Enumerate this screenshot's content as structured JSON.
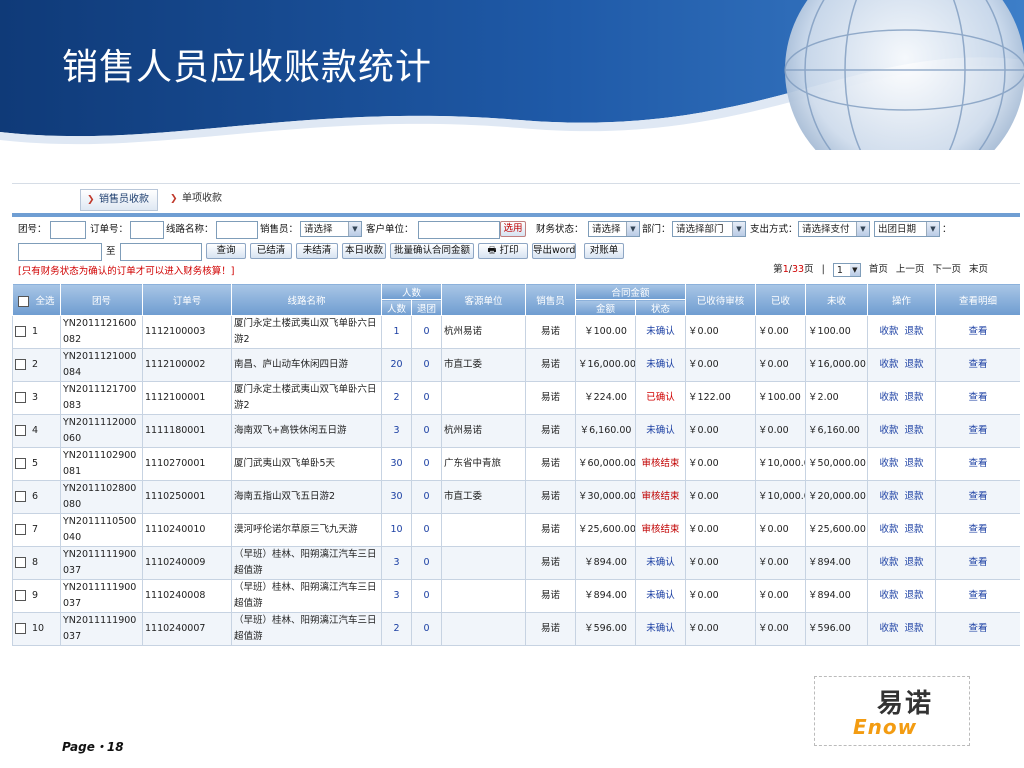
{
  "slide": {
    "title": "销售人员应收账款统计",
    "page_label": "Page・18",
    "logo_cn": "易诺",
    "logo_en": "Enow"
  },
  "tabs": [
    {
      "label": "销售员收款",
      "active": true
    },
    {
      "label": "单项收款",
      "active": false
    }
  ],
  "filters": {
    "group_no_label": "团号：",
    "order_no_label": "订单号：",
    "route_label": "线路名称：",
    "sales_label": "销售员：",
    "sales_value": "请选择",
    "customer_label": "客户单位：",
    "pick_button": "选用",
    "finance_status_label": "财务状态：",
    "finance_status_value": "请选择",
    "dept_label": "部门：",
    "dept_value": "请选择部门",
    "pay_method_label": "支出方式：",
    "pay_method_value": "请选择支付",
    "date_type_value": "出团日期",
    "date_colon": "：",
    "to_label": "至",
    "buttons": {
      "query": "查询",
      "settled": "已结清",
      "unsettled": "未结清",
      "today": "本日收款",
      "batch_confirm": "批量确认合同金额",
      "print": "打印",
      "export": "导出word",
      "reconcile": "对账单"
    },
    "warning": "[只有财务状态为确认的订单才可以进入财务核算！]"
  },
  "pager": {
    "prefix": "第",
    "current": "1",
    "sep": "/",
    "total": "33",
    "suffix": "页",
    "divider": "|",
    "select_value": "1",
    "first": "首页",
    "prev": "上一页",
    "next": "下一页",
    "last": "末页"
  },
  "table": {
    "headers": {
      "select_all": "全选",
      "group_no": "团号",
      "order_no": "订单号",
      "route": "线路名称",
      "people": "人数",
      "people_count": "人数",
      "people_return": "退团",
      "source": "客源单位",
      "sales": "销售员",
      "contract": "合同金额",
      "amount": "金额",
      "status": "状态",
      "received_pending": "已收待审核",
      "received": "已收",
      "unreceived": "未收",
      "action": "操作",
      "detail": "查看明细"
    },
    "action_collect": "收款",
    "action_refund": "退款",
    "detail_link": "查看",
    "rows": [
      {
        "idx": "1",
        "group_no": "YN2011121600082",
        "order_no": "1112100003",
        "route": "厦门永定土楼武夷山双飞单卧六日游2",
        "count": "1",
        "ret": "0",
        "source": "杭州易诺",
        "sales": "易诺",
        "amount": "￥100.00",
        "status": "未确认",
        "pending": "￥0.00",
        "received": "￥0.00",
        "unreceived": "￥100.00"
      },
      {
        "idx": "2",
        "group_no": "YN2011121000084",
        "order_no": "1112100002",
        "route": "南昌、庐山动车休闲四日游",
        "count": "20",
        "ret": "0",
        "source": "市直工委",
        "sales": "易诺",
        "amount": "￥16,000.00",
        "status": "未确认",
        "pending": "￥0.00",
        "received": "￥0.00",
        "unreceived": "￥16,000.00"
      },
      {
        "idx": "3",
        "group_no": "YN2011121700083",
        "order_no": "1112100001",
        "route": "厦门永定土楼武夷山双飞单卧六日游2",
        "count": "2",
        "ret": "0",
        "source": "",
        "sales": "易诺",
        "amount": "￥224.00",
        "status": "已确认",
        "pending": "￥122.00",
        "received": "￥100.00",
        "unreceived": "￥2.00"
      },
      {
        "idx": "4",
        "group_no": "YN2011112000060",
        "order_no": "1111180001",
        "route": "海南双飞+高铁休闲五日游",
        "count": "3",
        "ret": "0",
        "source": "杭州易诺",
        "sales": "易诺",
        "amount": "￥6,160.00",
        "status": "未确认",
        "pending": "￥0.00",
        "received": "￥0.00",
        "unreceived": "￥6,160.00"
      },
      {
        "idx": "5",
        "group_no": "YN2011102900081",
        "order_no": "1110270001",
        "route": "厦门武夷山双飞单卧5天",
        "count": "30",
        "ret": "0",
        "source": "广东省中青旅",
        "sales": "易诺",
        "amount": "￥60,000.00",
        "status": "审核结束",
        "pending": "￥0.00",
        "received": "￥10,000.00",
        "unreceived": "￥50,000.00"
      },
      {
        "idx": "6",
        "group_no": "YN2011102800080",
        "order_no": "1110250001",
        "route": "海南五指山双飞五日游2",
        "count": "30",
        "ret": "0",
        "source": "市直工委",
        "sales": "易诺",
        "amount": "￥30,000.00",
        "status": "审核结束",
        "pending": "￥0.00",
        "received": "￥10,000.00",
        "unreceived": "￥20,000.00"
      },
      {
        "idx": "7",
        "group_no": "YN2011110500040",
        "order_no": "1110240010",
        "route": "漠河呼伦诺尔草原三飞九天游",
        "count": "10",
        "ret": "0",
        "source": "",
        "sales": "易诺",
        "amount": "￥25,600.00",
        "status": "审核结束",
        "pending": "￥0.00",
        "received": "￥0.00",
        "unreceived": "￥25,600.00"
      },
      {
        "idx": "8",
        "group_no": "YN2011111900037",
        "order_no": "1110240009",
        "route": "（早班）桂林、阳朔漓江汽车三日超值游",
        "count": "3",
        "ret": "0",
        "source": "",
        "sales": "易诺",
        "amount": "￥894.00",
        "status": "未确认",
        "pending": "￥0.00",
        "received": "￥0.00",
        "unreceived": "￥894.00"
      },
      {
        "idx": "9",
        "group_no": "YN2011111900037",
        "order_no": "1110240008",
        "route": "（早班）桂林、阳朔漓江汽车三日超值游",
        "count": "3",
        "ret": "0",
        "source": "",
        "sales": "易诺",
        "amount": "￥894.00",
        "status": "未确认",
        "pending": "￥0.00",
        "received": "￥0.00",
        "unreceived": "￥894.00"
      },
      {
        "idx": "10",
        "group_no": "YN2011111900037",
        "order_no": "1110240007",
        "route": "（早班）桂林、阳朔漓江汽车三日超值游",
        "count": "2",
        "ret": "0",
        "source": "",
        "sales": "易诺",
        "amount": "￥596.00",
        "status": "未确认",
        "pending": "￥0.00",
        "received": "￥0.00",
        "unreceived": "￥596.00"
      }
    ]
  }
}
